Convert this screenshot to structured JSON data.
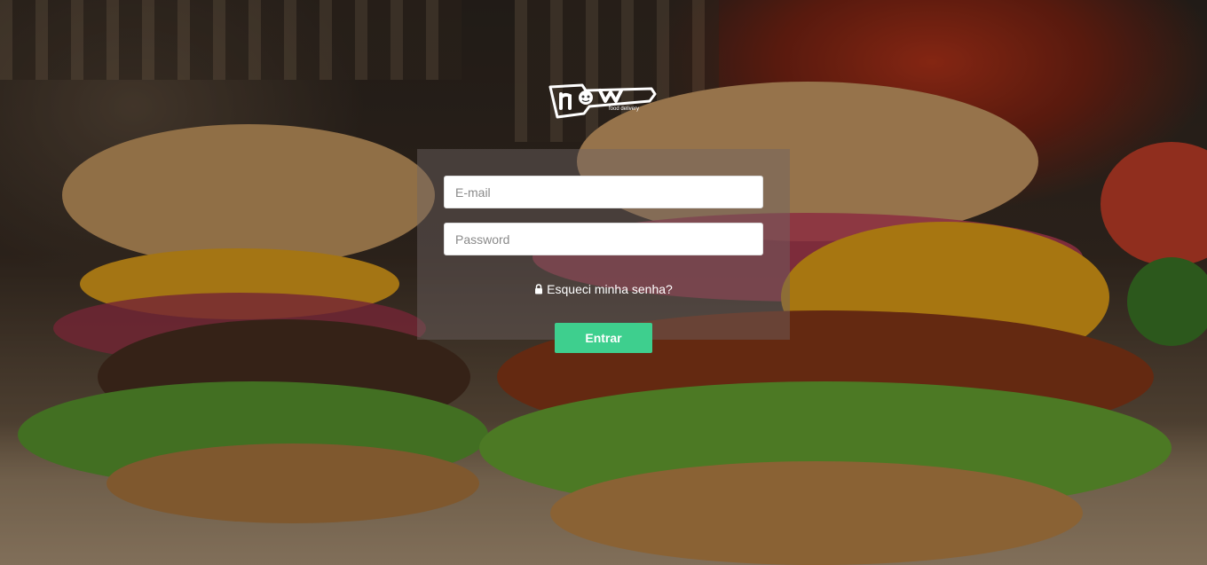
{
  "logo": {
    "text": "now",
    "tagline": "food delivery"
  },
  "login": {
    "email_placeholder": "E-mail",
    "password_placeholder": "Password",
    "forgot_label": "Esqueci minha senha?",
    "submit_label": "Entrar"
  },
  "colors": {
    "accent": "#3ecf8e",
    "panel": "rgba(110,100,100,0.45)",
    "text_light": "#ffffff"
  },
  "icons": {
    "forgot": "lock-icon"
  }
}
